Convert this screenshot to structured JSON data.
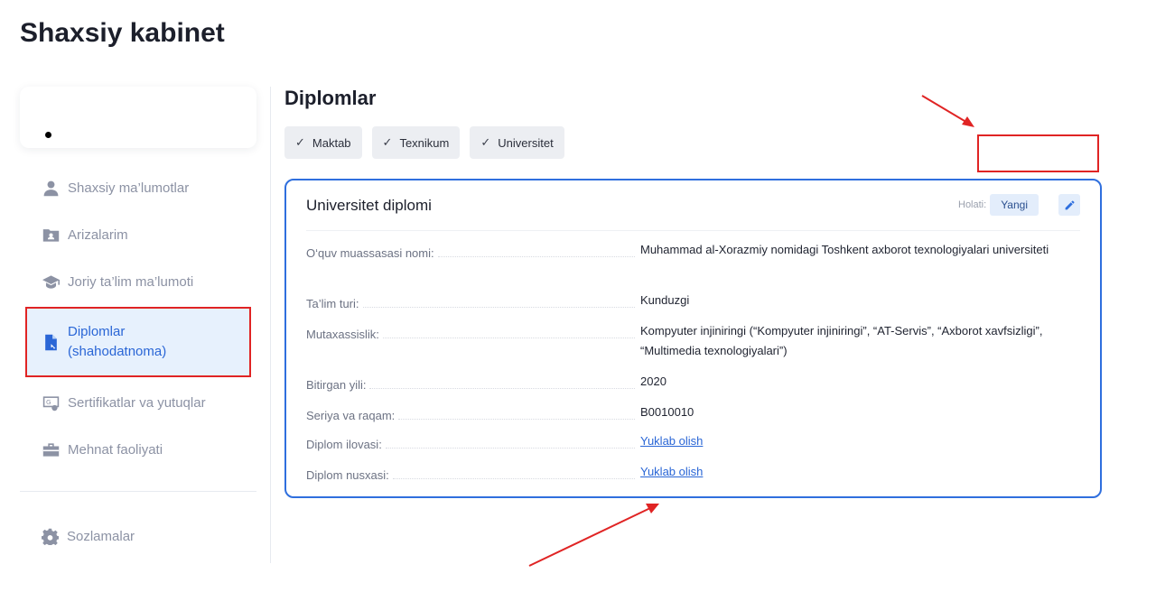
{
  "page": {
    "title": "Shaxsiy kabinet"
  },
  "sidebar": {
    "items": [
      {
        "label": "Shaxsiy ma’lumotlar",
        "icon": "user-icon"
      },
      {
        "label": "Arizalarim",
        "icon": "folder-user-icon"
      },
      {
        "label": "Joriy ta’lim ma’lumoti",
        "icon": "graduation-cap-icon"
      },
      {
        "label_line1": "Diplomlar",
        "label_line2": "(shahodatnoma)",
        "icon": "document-icon",
        "active": true
      },
      {
        "label": "Sertifikatlar va yutuqlar",
        "icon": "certificate-icon"
      },
      {
        "label": "Mehnat faoliyati",
        "icon": "briefcase-icon"
      }
    ],
    "settings_label": "Sozlamalar"
  },
  "main": {
    "title": "Diplomlar",
    "tabs": [
      {
        "label": "Maktab"
      },
      {
        "label": "Texnikum"
      },
      {
        "label": "Universitet"
      }
    ],
    "card": {
      "title": "Universitet diplomi",
      "status_label": "Holati:",
      "status_value": "Yangi",
      "rows": [
        {
          "key": "O‘quv muassasasi nomi:",
          "value": "Muhammad al-Xorazmiy nomidagi Toshkent axborot texnologiyalari universiteti"
        },
        {
          "key": "Ta’lim turi:",
          "value": "Kunduzgi"
        },
        {
          "key": "Mutaxassislik:",
          "value": "Kompyuter injiniringi (“Kompyuter injiniringi”, “AT-Servis”, “Axborot xavfsizligi”, “Multimedia texnologiyalari”)"
        },
        {
          "key": "Bitirgan yili:",
          "value": "2020"
        },
        {
          "key": "Seriya va raqam:",
          "value": "B0010010"
        },
        {
          "key": "Diplom ilovasi:",
          "value": "Yuklab olish",
          "link": true
        },
        {
          "key": "Diplom nusxasi:",
          "value": "Yuklab olish",
          "link": true
        }
      ]
    }
  },
  "colors": {
    "accent": "#2f6fde",
    "annotation": "#e02424",
    "active_bg": "#e7f1fd"
  }
}
